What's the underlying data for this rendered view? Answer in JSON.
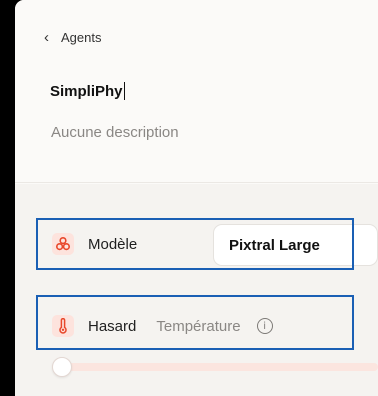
{
  "nav": {
    "back_label": "Agents"
  },
  "agent": {
    "name": "SimpliPhy",
    "description": "Aucune description"
  },
  "model_setting": {
    "label": "Modèle",
    "value": "Pixtral Large"
  },
  "temperature_setting": {
    "label": "Hasard",
    "sublabel": "Température",
    "value": 0
  },
  "colors": {
    "accent": "#e8472a",
    "highlight": "#1a5fb4",
    "icon_bg": "#fde3dd"
  }
}
